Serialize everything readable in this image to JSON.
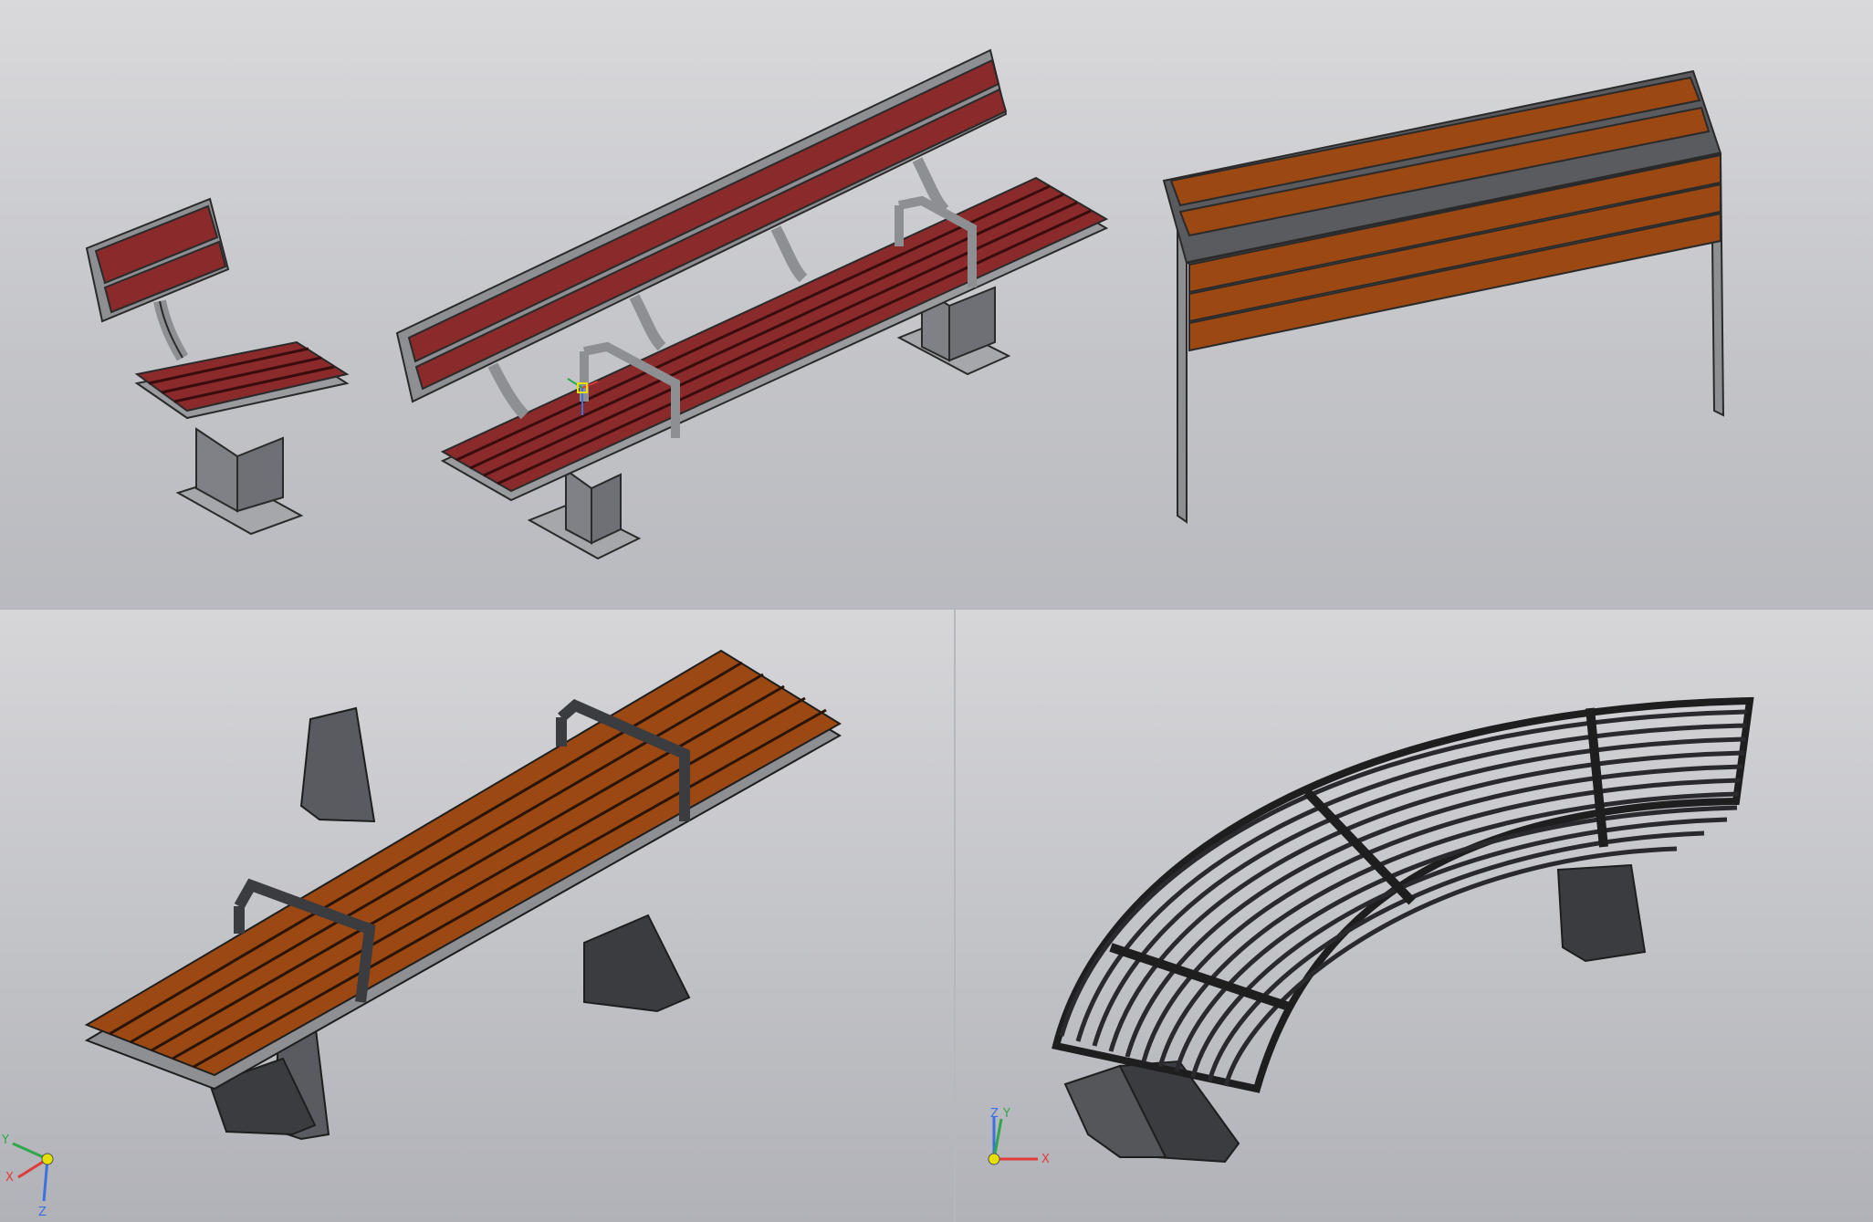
{
  "viewports": {
    "top": {
      "models": [
        "chair-bench",
        "long-bench-with-back",
        "back-panel-bench"
      ]
    },
    "bottom_left": {
      "models": [
        "backless-bench-with-armrests"
      ],
      "axes": {
        "x": "X",
        "y": "Y",
        "z": "Z"
      }
    },
    "bottom_right": {
      "models": [
        "curved-metal-bench"
      ],
      "axes": {
        "x": "X",
        "y": "Y",
        "z": "Z"
      }
    }
  },
  "colors": {
    "wood_red": "#8a2a2a",
    "wood_orange": "#9b4813",
    "metal": "#8e8f93",
    "metal_dark": "#3b3c40",
    "axis_x": "#e03a3a",
    "axis_y": "#2fa84a",
    "axis_z": "#3a72e0"
  }
}
